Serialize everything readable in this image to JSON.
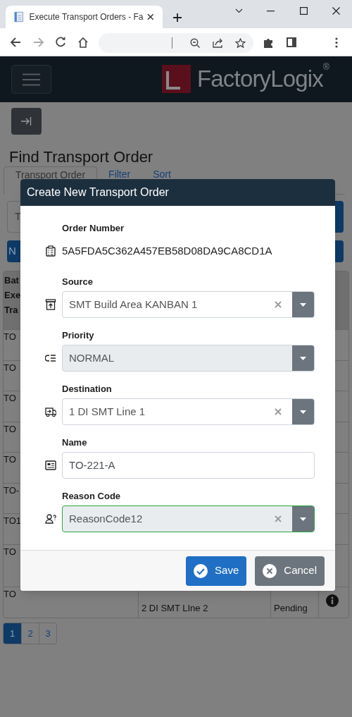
{
  "browser": {
    "tab_title": "Execute Transport Orders - Fa"
  },
  "app_header": {
    "logo_light": "Factory",
    "logo_bold": "Logix",
    "logo_mark": "®"
  },
  "page": {
    "title": "Find Transport Order",
    "tabs": [
      {
        "label": "Transport Order",
        "selected": true
      },
      {
        "label": "Filter",
        "selected": false
      },
      {
        "label": "Sort",
        "selected": false
      }
    ],
    "search_field": {
      "placeholder": "T"
    },
    "new_button": "N",
    "table": {
      "header": [
        "Bat",
        "Exe",
        "Tra"
      ],
      "rows": [
        {
          "column_1": "TO"
        },
        {
          "column_1": "TO"
        },
        {
          "column_1": "TO"
        },
        {
          "column_1": "TO"
        },
        {
          "column_1": "TO"
        },
        {
          "column_1": "TO-"
        },
        {
          "column_1": "TO1"
        },
        {
          "column_1": "TO"
        },
        {
          "column_1": "TO",
          "column_2": "2 DI SMT LIne 2",
          "column_3": "Pending",
          "info": true
        }
      ]
    },
    "pagination": [
      {
        "label": "1",
        "selected": true
      },
      {
        "label": "2",
        "selected": false
      },
      {
        "label": "3",
        "selected": false
      }
    ]
  },
  "modal": {
    "title": "Create New Transport Order",
    "fields": [
      {
        "kind": "text",
        "label": "Order Number",
        "value": "5A5FDA5C362A457EB58D08DA9CA8CD1A"
      },
      {
        "kind": "select",
        "label": "Source",
        "value": "SMT Build Area KANBAN 1",
        "clearable": true,
        "disabled": false,
        "valid": false
      },
      {
        "kind": "select",
        "label": "Priority",
        "value": "NORMAL",
        "clearable": false,
        "disabled": true,
        "valid": false
      },
      {
        "kind": "select",
        "label": "Destination",
        "value": "1 DI SMT Line 1",
        "clearable": true,
        "disabled": false,
        "valid": false
      },
      {
        "kind": "input",
        "label": "Name",
        "value": "TO-221-A"
      },
      {
        "kind": "select",
        "label": "Reason Code",
        "value": "ReasonCode12",
        "clearable": true,
        "disabled": true,
        "valid": true
      }
    ],
    "buttons": [
      {
        "kind": "primary",
        "label": "Save"
      },
      {
        "kind": "secondary",
        "label": "Cancel"
      }
    ]
  }
}
